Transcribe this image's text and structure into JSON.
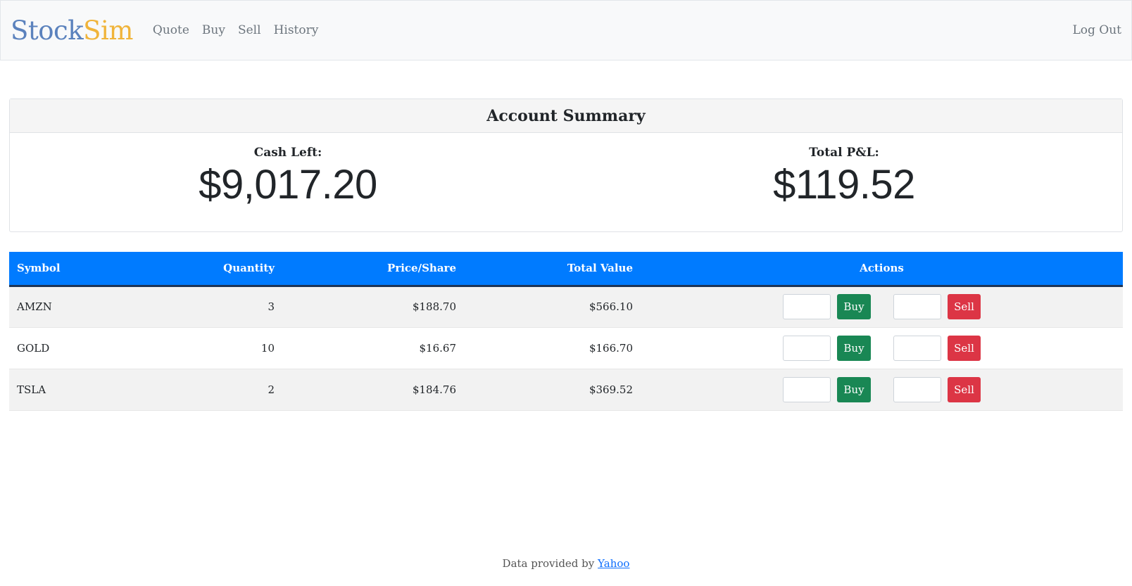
{
  "nav": {
    "brand_part1": "Stock",
    "brand_part2": "Sim",
    "links": [
      "Quote",
      "Buy",
      "Sell",
      "History"
    ],
    "logout": "Log Out"
  },
  "summary": {
    "title": "Account Summary",
    "cash_label": "Cash Left:",
    "cash_value": "$9,017.20",
    "pl_label": "Total P&L:",
    "pl_value": "$119.52"
  },
  "table": {
    "headers": [
      "Symbol",
      "Quantity",
      "Price/Share",
      "Total Value",
      "Actions"
    ],
    "rows": [
      {
        "symbol": "AMZN",
        "quantity": "3",
        "price": "$188.70",
        "total": "$566.10",
        "buy_qty": "",
        "sell_qty": ""
      },
      {
        "symbol": "GOLD",
        "quantity": "10",
        "price": "$16.67",
        "total": "$166.70",
        "buy_qty": "",
        "sell_qty": ""
      },
      {
        "symbol": "TSLA",
        "quantity": "2",
        "price": "$184.76",
        "total": "$369.52",
        "buy_qty": "",
        "sell_qty": ""
      }
    ],
    "buy_label": "Buy",
    "sell_label": "Sell"
  },
  "footer": {
    "text": "Data provided by",
    "link": "Yahoo"
  },
  "colors": {
    "brand_primary": "#5b82bd",
    "brand_accent": "#f0b43a",
    "table_header": "#007bff",
    "buy_button": "#198754",
    "sell_button": "#dc3545"
  }
}
